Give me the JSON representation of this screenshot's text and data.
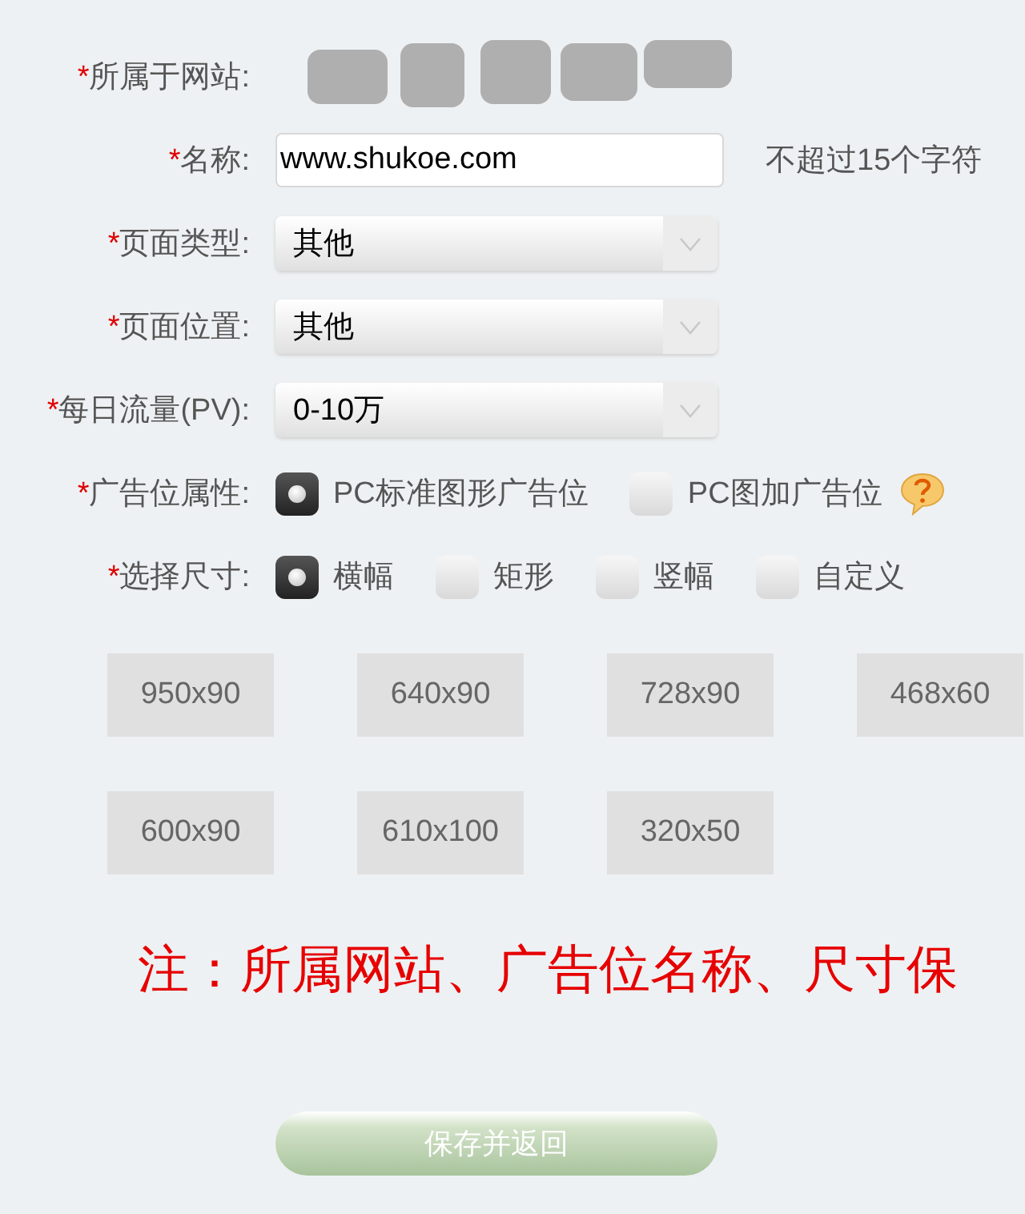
{
  "form": {
    "fields": [
      {
        "kind": "redacted",
        "mark": "*",
        "label": "所属于网站:"
      },
      {
        "kind": "text",
        "mark": "*",
        "label": "名称:",
        "value": "www.shukoe.com",
        "hint": "不超过15个字符"
      },
      {
        "kind": "select",
        "mark": "*",
        "label": "页面类型:",
        "value": "其他"
      },
      {
        "kind": "select",
        "mark": "*",
        "label": "页面位置:",
        "value": "其他"
      },
      {
        "kind": "select",
        "mark": "*",
        "label": "每日流量(PV):",
        "value": "0-10万"
      },
      {
        "kind": "radio",
        "mark": "*",
        "label": "广告位属性:",
        "help": true,
        "options": [
          {
            "label": "PC标准图形广告位",
            "selected": true
          },
          {
            "label": "PC图加广告位",
            "selected": false
          }
        ]
      },
      {
        "kind": "radio",
        "mark": "*",
        "label": "选择尺寸:",
        "help": false,
        "options": [
          {
            "label": "横幅",
            "selected": true
          },
          {
            "label": "矩形",
            "selected": false
          },
          {
            "label": "竖幅",
            "selected": false
          },
          {
            "label": "自定义",
            "selected": false
          }
        ]
      }
    ]
  },
  "size_presets": [
    "950x90",
    "640x90",
    "728x90",
    "468x60",
    "600x90",
    "610x100",
    "320x50"
  ],
  "note": "注：所属网站、广告位名称、尺寸保",
  "save_button": {
    "label": "保存并返回"
  }
}
